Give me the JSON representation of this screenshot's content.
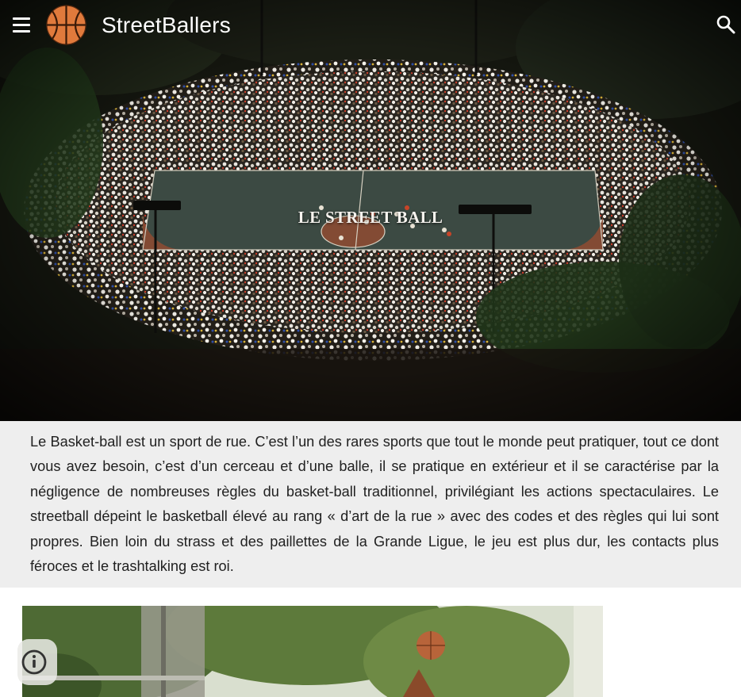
{
  "appbar": {
    "menu_icon": "menu-icon",
    "logo_icon": "basketball-logo-icon",
    "brand": "StreetBallers",
    "search_icon": "search-icon"
  },
  "hero": {
    "title": "LE STREET BALL"
  },
  "intro": {
    "text": "Le Basket-ball est un sport de rue. C’est l’un des rares sports que tout le monde peut pratiquer, tout ce dont vous avez besoin, c’est d’un cerceau et d’une balle, il se pratique en extérieur et il se caractérise par la négligence de nombreuses règles du basket-ball traditionnel, privilégiant les actions spectaculaires. Le streetball dépeint le basketball élevé au rang « d’art de la rue » avec des codes et des règles qui lui sont propres. Bien loin du strass et des paillettes de la Grande Ligue, le jeu est plus dur, les contacts plus féroces et le trashtalking est roi."
  },
  "info_button": {
    "icon": "info-icon"
  },
  "colors": {
    "intro_background": "#eeeeee",
    "text": "#212121",
    "logo_orange": "#e07a3c"
  }
}
